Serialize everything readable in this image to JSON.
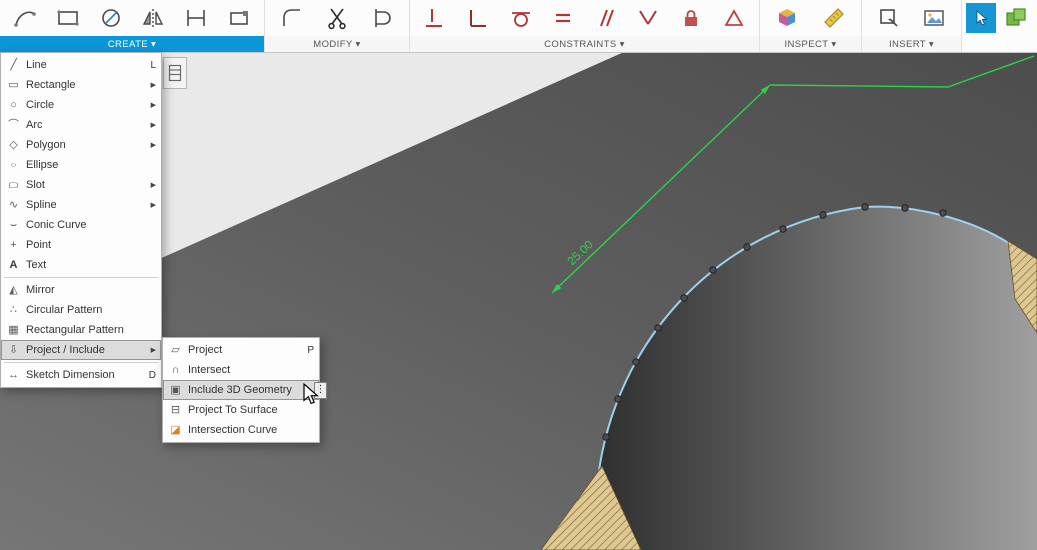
{
  "toolbar": {
    "groups": [
      {
        "name": "create",
        "label": "CREATE ▾"
      },
      {
        "name": "modify",
        "label": "MODIFY ▾"
      },
      {
        "name": "constraints",
        "label": "CONSTRAINTS ▾"
      },
      {
        "name": "inspect",
        "label": "INSPECT ▾"
      },
      {
        "name": "insert",
        "label": "INSERT ▾"
      }
    ]
  },
  "create_menu": {
    "items": [
      {
        "name": "line",
        "label": "Line",
        "shortcut": "L",
        "glyph": "╱"
      },
      {
        "name": "rectangle",
        "label": "Rectangle",
        "submenu": true,
        "glyph": "▭"
      },
      {
        "name": "circle",
        "label": "Circle",
        "submenu": true,
        "glyph": "○"
      },
      {
        "name": "arc",
        "label": "Arc",
        "submenu": true,
        "glyph": "⌒"
      },
      {
        "name": "polygon",
        "label": "Polygon",
        "submenu": true,
        "glyph": "◇"
      },
      {
        "name": "ellipse",
        "label": "Ellipse",
        "glyph": "○"
      },
      {
        "name": "slot",
        "label": "Slot",
        "submenu": true,
        "glyph": "▢"
      },
      {
        "name": "spline",
        "label": "Spline",
        "submenu": true,
        "glyph": "∿"
      },
      {
        "name": "conic-curve",
        "label": "Conic Curve",
        "glyph": "⌣"
      },
      {
        "name": "point",
        "label": "Point",
        "glyph": "+"
      },
      {
        "name": "text",
        "label": "Text",
        "glyph": "A"
      },
      {
        "separator": true
      },
      {
        "name": "mirror",
        "label": "Mirror",
        "glyph": "◭"
      },
      {
        "name": "circular-pattern",
        "label": "Circular Pattern",
        "glyph": "∴"
      },
      {
        "name": "rectangular-pattern",
        "label": "Rectangular Pattern",
        "glyph": "▦"
      },
      {
        "name": "project-include",
        "label": "Project / Include",
        "submenu": true,
        "highlighted": true,
        "glyph": "⇩"
      },
      {
        "separator": true
      },
      {
        "name": "sketch-dimension",
        "label": "Sketch Dimension",
        "shortcut": "D",
        "glyph": "↔"
      }
    ]
  },
  "project_submenu": {
    "items": [
      {
        "name": "project",
        "label": "Project",
        "shortcut": "P",
        "glyph": "▱"
      },
      {
        "name": "intersect",
        "label": "Intersect",
        "glyph": "∩"
      },
      {
        "name": "include-3d-geometry",
        "label": "Include 3D Geometry",
        "highlighted": true,
        "kebab": true,
        "glyph": "▣"
      },
      {
        "name": "project-to-surface",
        "label": "Project To Surface",
        "glyph": "⊟"
      },
      {
        "name": "intersection-curve",
        "label": "Intersection Curve",
        "glyph": "◪",
        "glyph_color": "#e07b26"
      }
    ]
  },
  "canvas": {
    "dimension_label": "25.00",
    "colors": {
      "accent_blue": "#0a96d7",
      "selection_green": "#2bd348",
      "edge_blue": "#9cd0ef",
      "model_gray": "#5e5e5e",
      "hatch_tan": "#ddc894"
    }
  }
}
